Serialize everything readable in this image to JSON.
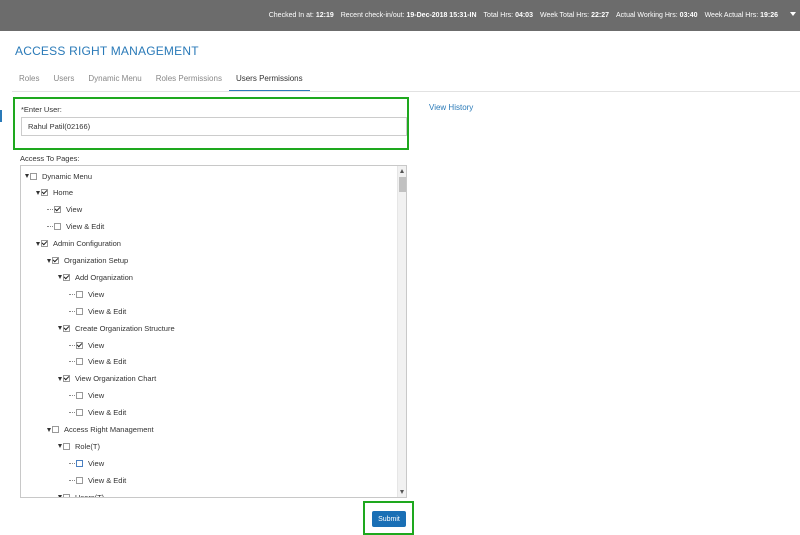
{
  "header": {
    "stats": [
      {
        "label": "Checked In at:",
        "value": "12:19"
      },
      {
        "label": "Recent check-in/out:",
        "value": "19-Dec-2018 15:31-IN"
      },
      {
        "label": "Total Hrs:",
        "value": "04:03"
      },
      {
        "label": "Week Total Hrs:",
        "value": "22:27"
      },
      {
        "label": "Actual Working Hrs:",
        "value": "03:40"
      },
      {
        "label": "Week Actual Hrs:",
        "value": "19:26"
      }
    ]
  },
  "page": {
    "title": "ACCESS RIGHT MANAGEMENT"
  },
  "tabs": [
    {
      "label": "Roles"
    },
    {
      "label": "Users"
    },
    {
      "label": "Dynamic Menu"
    },
    {
      "label": "Roles Permissions"
    },
    {
      "label": "Users Permissions"
    }
  ],
  "active_tab": "Users Permissions",
  "form": {
    "user_label": "*Enter User:",
    "user_value": "Rahul Patil(02166)",
    "view_history": "View History",
    "access_label": "Access To Pages:",
    "submit_label": "Submit"
  },
  "tree": [
    {
      "label": "Dynamic Menu",
      "depth": 0,
      "expanded": true,
      "checked": false
    },
    {
      "label": "Home",
      "depth": 1,
      "expanded": true,
      "checked": true
    },
    {
      "label": "View",
      "depth": 2,
      "leaf": true,
      "checked": true
    },
    {
      "label": "View & Edit",
      "depth": 2,
      "leaf": true,
      "checked": false
    },
    {
      "label": "Admin Configuration",
      "depth": 1,
      "expanded": true,
      "checked": true
    },
    {
      "label": "Organization Setup",
      "depth": 2,
      "expanded": true,
      "checked": true
    },
    {
      "label": "Add Organization",
      "depth": 3,
      "expanded": true,
      "checked": true
    },
    {
      "label": "View",
      "depth": 4,
      "leaf": true,
      "checked": false
    },
    {
      "label": "View & Edit",
      "depth": 4,
      "leaf": true,
      "checked": false
    },
    {
      "label": "Create Organization Structure",
      "depth": 3,
      "expanded": true,
      "checked": true
    },
    {
      "label": "View",
      "depth": 4,
      "leaf": true,
      "checked": true
    },
    {
      "label": "View & Edit",
      "depth": 4,
      "leaf": true,
      "checked": false
    },
    {
      "label": "View Organization Chart",
      "depth": 3,
      "expanded": true,
      "checked": true
    },
    {
      "label": "View",
      "depth": 4,
      "leaf": true,
      "checked": false
    },
    {
      "label": "View & Edit",
      "depth": 4,
      "leaf": true,
      "checked": false
    },
    {
      "label": "Access Right Management",
      "depth": 2,
      "expanded": true,
      "checked": false
    },
    {
      "label": "Role(T)",
      "depth": 3,
      "expanded": true,
      "checked": false
    },
    {
      "label": "View",
      "depth": 4,
      "leaf": true,
      "checked": false,
      "focused": true
    },
    {
      "label": "View & Edit",
      "depth": 4,
      "leaf": true,
      "checked": false
    },
    {
      "label": "Users(T)",
      "depth": 3,
      "expanded": true,
      "checked": false
    }
  ],
  "colors": {
    "accent": "#2a7ab8",
    "highlight": "#1ea81e",
    "topbar": "#6c6c6c",
    "button": "#1a6fb5"
  }
}
